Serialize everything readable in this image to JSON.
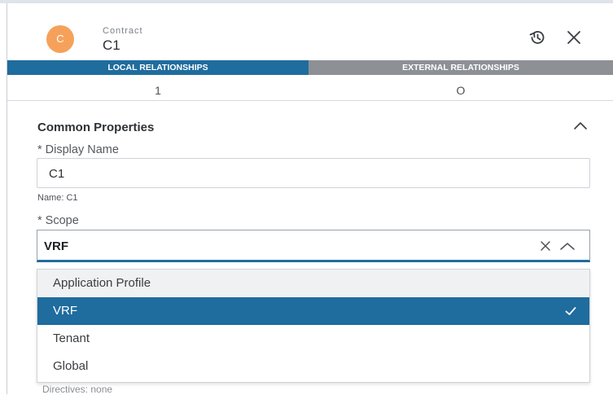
{
  "header": {
    "avatar_letter": "C",
    "object_type": "Contract",
    "object_name": "C1",
    "avatar_color": "#f6a15a",
    "icons": [
      "history-icon",
      "close-icon"
    ]
  },
  "relationships": {
    "tabs": [
      {
        "label": "LOCAL RELATIONSHIPS",
        "count": "1",
        "color": "#1f6c9e"
      },
      {
        "label": "EXTERNAL RELATIONSHIPS",
        "count": "O",
        "color": "#8d9095"
      }
    ]
  },
  "common_properties": {
    "title": "Common Properties",
    "display_name": {
      "label": "* Display Name",
      "value": "C1",
      "hint": "Name: C1"
    },
    "scope": {
      "label": "* Scope",
      "value": "VRF",
      "options": [
        "Application Profile",
        "VRF",
        "Tenant",
        "Global"
      ],
      "selected": "VRF"
    },
    "directives": "Directives: none"
  },
  "colors": {
    "accent": "#1f6c9e",
    "secondary": "#8d9095"
  }
}
